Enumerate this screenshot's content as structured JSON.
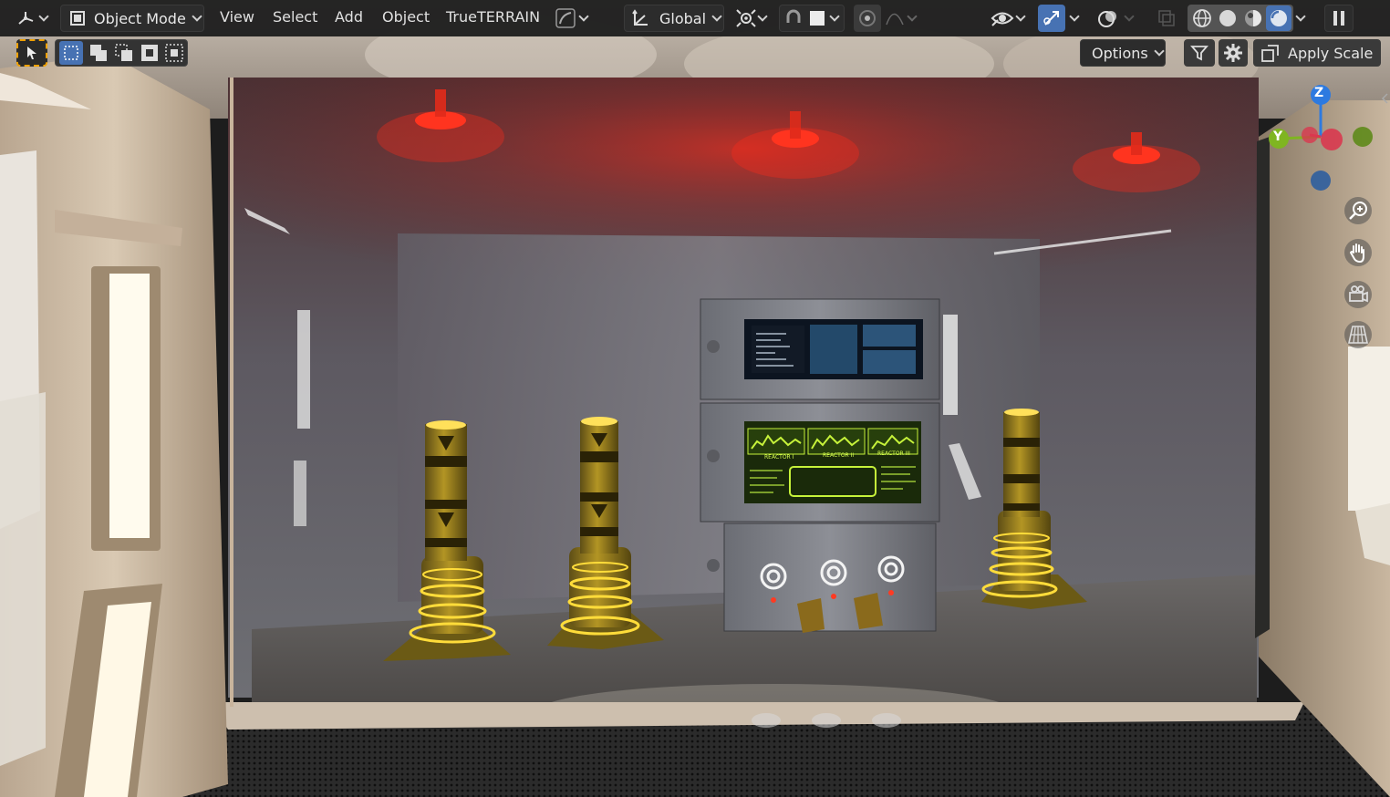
{
  "header": {
    "editor_type_icon": "axes-grid-icon",
    "mode": {
      "label": "Object Mode",
      "icon": "object-mode-cube-icon"
    },
    "menus": [
      "View",
      "Select",
      "Add",
      "Object",
      "TrueTERRAIN"
    ],
    "transform_orientation": {
      "label": "Global",
      "icon": "transform-axes-icon"
    },
    "pivot_icon": "pivot-point-icon",
    "snap_icon": "magnet-icon",
    "proportional_icon": "proportional-edit-icon",
    "overlay_icons": [
      "visibility-eye-icon",
      "gizmo-icon",
      "overlays-icon",
      "xray-icon"
    ],
    "shading_modes": [
      "wireframe",
      "solid",
      "material-preview",
      "rendered"
    ],
    "active_shading": "rendered"
  },
  "toolrow": {
    "select_modes": [
      "select-new",
      "select-extend",
      "select-subtract",
      "select-invert",
      "select-intersect"
    ],
    "options_label": "Options",
    "apply_scale_label": "Apply Scale"
  },
  "gizmo": {
    "axis_z": "Z",
    "axis_y": "Y",
    "colors": {
      "x": "#d9384f",
      "y": "#7fb521",
      "z": "#2d7ae0"
    }
  },
  "nav": [
    "zoom-icon",
    "hand-pan-icon",
    "camera-icon",
    "grid-perspective-icon"
  ],
  "screens": {
    "reactor_labels": [
      "REACTOR I",
      "REACTOR II",
      "REACTOR III"
    ]
  },
  "colors": {
    "header_bg": "#1e1e1e",
    "active_blue": "#4772b3",
    "selection_orange": "#f0a000"
  }
}
